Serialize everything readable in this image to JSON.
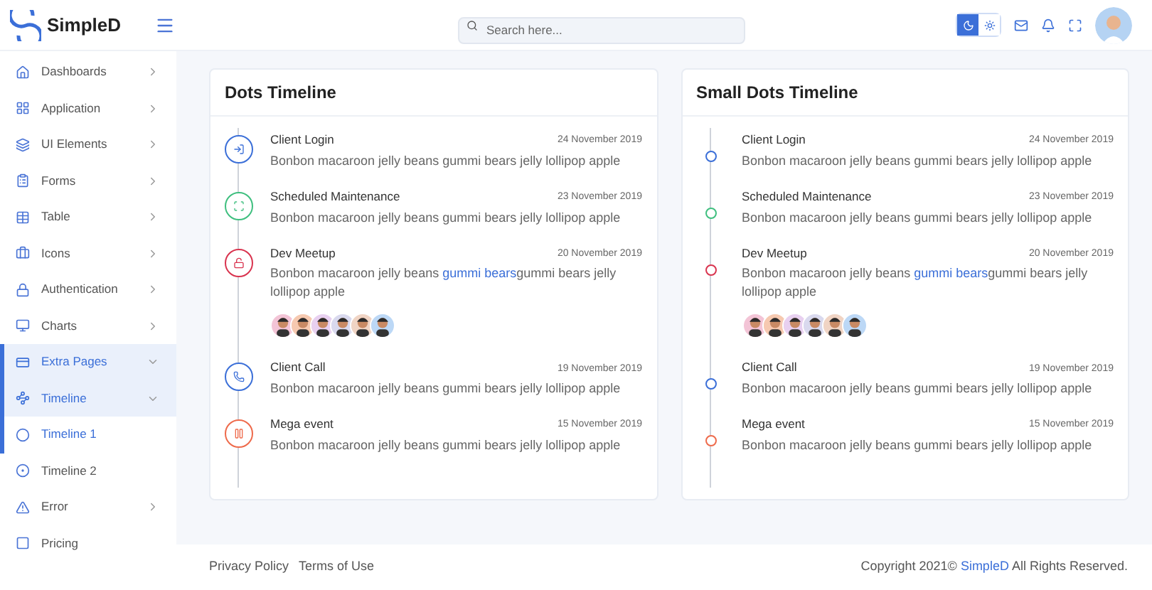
{
  "brand": {
    "name": "SimpleD"
  },
  "search": {
    "placeholder": "Search here..."
  },
  "theme_toggle": [
    {
      "kind": "dark",
      "selected": true
    },
    {
      "kind": "light",
      "selected": false
    }
  ],
  "sidebar": {
    "items": [
      {
        "label": "Dashboards",
        "kind": "group",
        "expanded": false
      },
      {
        "label": "Application",
        "kind": "group",
        "expanded": false
      },
      {
        "label": "UI Elements",
        "kind": "group",
        "expanded": false
      },
      {
        "label": "Forms",
        "kind": "group",
        "expanded": false
      },
      {
        "label": "Table",
        "kind": "group",
        "expanded": false
      },
      {
        "label": "Icons",
        "kind": "group",
        "expanded": false
      },
      {
        "label": "Authentication",
        "kind": "group",
        "expanded": false
      },
      {
        "label": "Charts",
        "kind": "group",
        "expanded": false
      },
      {
        "label": "Extra Pages",
        "kind": "group",
        "expanded": true
      },
      {
        "label": "Timeline",
        "kind": "group",
        "expanded": true,
        "children": [
          {
            "label": "Timeline 1",
            "selected": true
          },
          {
            "label": "Timeline 2",
            "selected": false
          }
        ]
      },
      {
        "label": "Error",
        "kind": "group",
        "expanded": false
      },
      {
        "label": "Pricing",
        "kind": "link",
        "expanded": false
      }
    ]
  },
  "timelines": [
    {
      "title": "Dots Timeline",
      "kind": "icon",
      "items": [
        {
          "title": "Client Login",
          "date": "24 November 2019",
          "text": "Bonbon macaroon jelly beans gummi bears jelly lollipop apple",
          "color": "#3b6fd8"
        },
        {
          "title": "Scheduled Maintenance",
          "date": "23 November 2019",
          "text": "Bonbon macaroon jelly beans gummi bears jelly lollipop apple",
          "color": "#3fbf7f"
        },
        {
          "title": "Dev Meetup",
          "date": "20 November 2019",
          "text": "Bonbon macaroon jelly beans ",
          "link": "gummi bears",
          "text_after": "gummi bears jelly lollipop apple",
          "color": "#d9344f"
        },
        {
          "title": "Client Call",
          "date": "19 November 2019",
          "text": "Bonbon macaroon jelly beans gummi bears jelly lollipop apple",
          "color": "#3b6fd8"
        },
        {
          "title": "Mega event",
          "date": "15 November 2019",
          "text": "Bonbon macaroon jelly beans gummi bears jelly lollipop apple",
          "color": "#ee6a4b"
        }
      ]
    },
    {
      "title": "Small Dots Timeline",
      "kind": "dot",
      "items": [
        {
          "title": "Client Login",
          "date": "24 November 2019",
          "text": "Bonbon macaroon jelly beans gummi bears jelly lollipop apple",
          "color": "#3b6fd8"
        },
        {
          "title": "Scheduled Maintenance",
          "date": "23 November 2019",
          "text": "Bonbon macaroon jelly beans gummi bears jelly lollipop apple",
          "color": "#3fbf7f"
        },
        {
          "title": "Dev Meetup",
          "date": "20 November 2019",
          "text": "Bonbon macaroon jelly beans ",
          "link": "gummi bears",
          "text_after": "gummi bears jelly lollipop apple",
          "color": "#d9344f"
        },
        {
          "title": "Client Call",
          "date": "19 November 2019",
          "text": "Bonbon macaroon jelly beans gummi bears jelly lollipop apple",
          "color": "#3b6fd8"
        },
        {
          "title": "Mega event",
          "date": "15 November 2019",
          "text": "Bonbon macaroon jelly beans gummi bears jelly lollipop apple",
          "color": "#ee6a4b"
        }
      ]
    }
  ],
  "footer": {
    "links": [
      "Privacy Policy",
      "Terms of Use"
    ],
    "copyright": "Copyright 2021© ",
    "copyright_link": "SimpleD",
    "copyright_after": " All Rights Reserved."
  }
}
